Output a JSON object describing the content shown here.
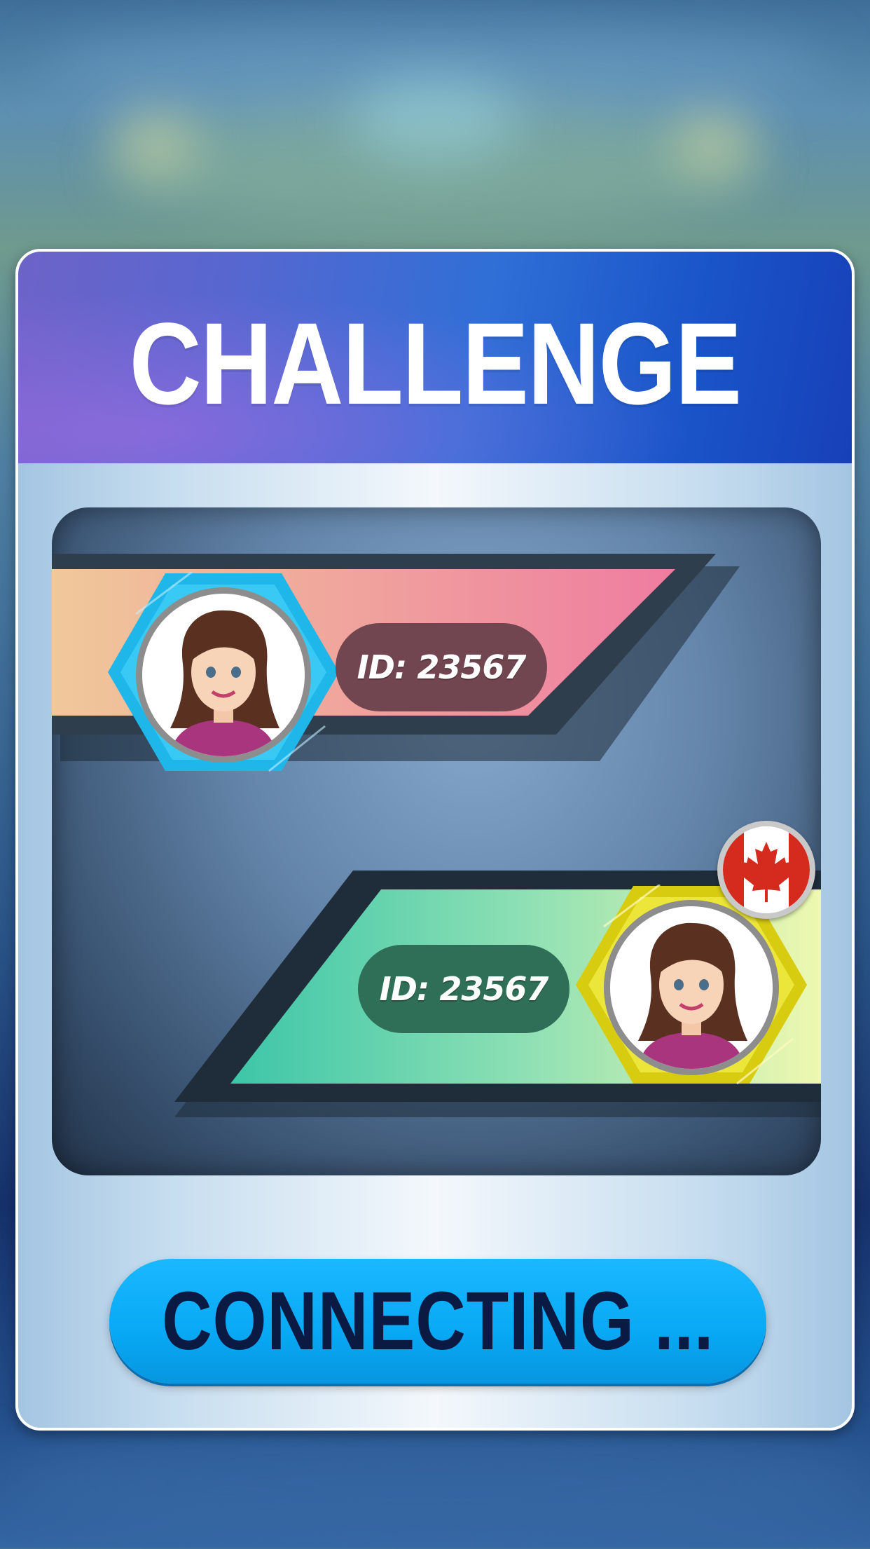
{
  "dialog": {
    "title": "CHALLENGE",
    "players": [
      {
        "id_label": "ID: 23567",
        "side": "left",
        "accent": "#1fb6ea"
      },
      {
        "id_label": "ID: 23567",
        "side": "right",
        "accent": "#e2d21c",
        "flag": "canada-flag-icon"
      }
    ],
    "status_button": {
      "label": "CONNECTING ..."
    }
  },
  "colors": {
    "header": "#2f6fd6",
    "button": "#08a8f4",
    "button_text": "#0a1a42",
    "band_top": [
      "#f0c89a",
      "#ef7ca0"
    ],
    "band_bottom": [
      "#3cc6a8",
      "#eef8b0"
    ]
  }
}
